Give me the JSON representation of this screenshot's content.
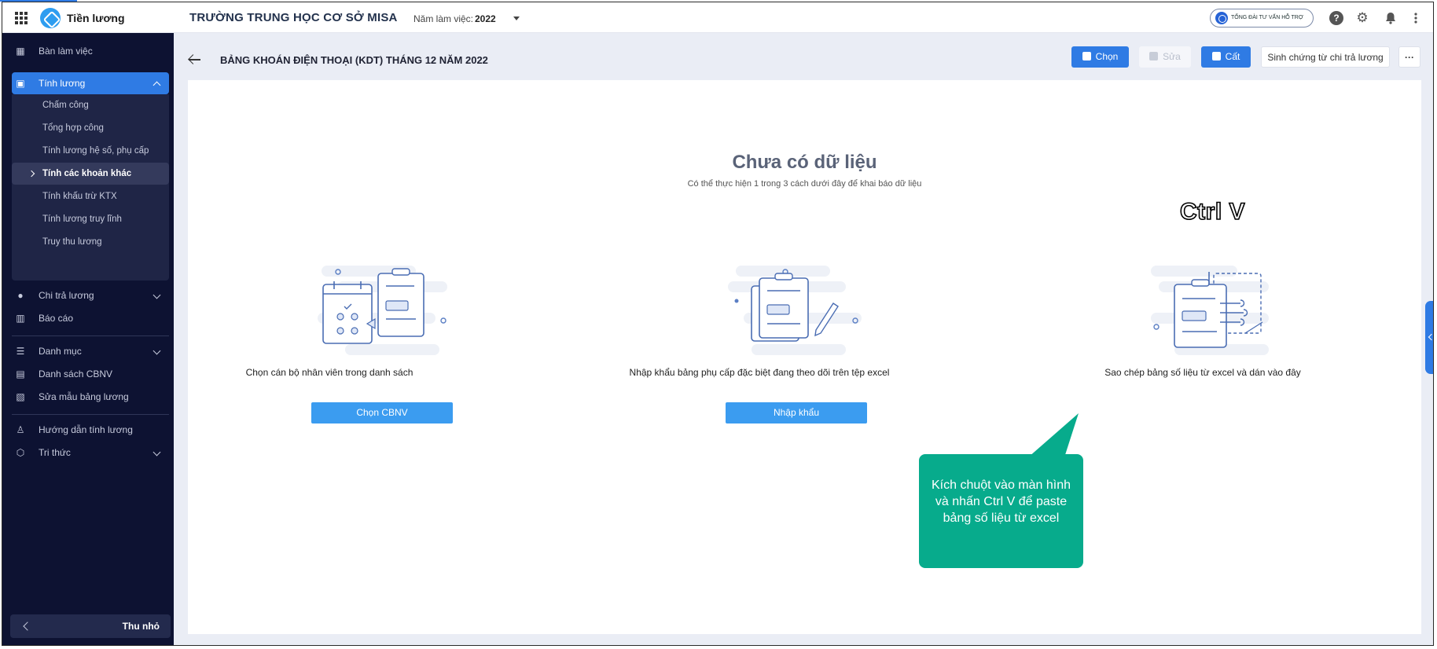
{
  "topbar": {
    "app_name": "Tiền lương",
    "school": "TRƯỜNG TRUNG HỌC CƠ SỞ MISA",
    "year_label": "Năm làm việc:",
    "year_value": "2022",
    "hotline": "TỔNG ĐÀI TƯ VẤN HỖ TRỢ"
  },
  "sidebar": {
    "items": [
      {
        "label": "Bàn làm việc"
      },
      {
        "label": "Tính lương"
      },
      {
        "label": "Chi trả lương"
      },
      {
        "label": "Báo cáo"
      },
      {
        "label": "Danh mục"
      },
      {
        "label": "Danh sách CBNV"
      },
      {
        "label": "Sửa mẫu bảng lương"
      },
      {
        "label": "Hướng dẫn tính lương"
      },
      {
        "label": "Tri thức"
      }
    ],
    "submenu": [
      {
        "label": "Chấm công"
      },
      {
        "label": "Tổng hợp công"
      },
      {
        "label": "Tính lương hệ số, phụ cấp"
      },
      {
        "label": "Tính các khoản khác"
      },
      {
        "label": "Tính khấu trừ KTX"
      },
      {
        "label": "Tính lương truy lĩnh"
      },
      {
        "label": "Truy thu lương"
      }
    ],
    "collapse_label": "Thu nhỏ"
  },
  "header": {
    "title": "BẢNG KHOÁN ĐIỆN THOẠI (KDT) THÁNG 12 NĂM 2022",
    "btn_choose": "Chọn",
    "btn_edit": "Sửa",
    "btn_save": "Cất",
    "btn_generate": "Sinh chứng từ chi trả lương",
    "btn_more": "···"
  },
  "empty": {
    "title": "Chưa có dữ liệu",
    "subtitle": "Có thể thực hiện 1 trong 3 cách dưới đây để khai báo dữ liệu",
    "ctrlv": "Ctrl V",
    "options": [
      {
        "label": "Chọn cán bộ nhân viên trong danh sách",
        "button": "Chọn CBNV"
      },
      {
        "label": "Nhập khẩu bảng phụ cấp đặc biệt đang theo dõi trên tệp excel",
        "button": "Nhập khẩu"
      },
      {
        "label": "Sao chép bảng số liệu từ excel và dán vào đây"
      }
    ]
  },
  "callout": {
    "text": "Kích chuột vào màn hình và nhấn Ctrl V để paste bảng số liệu từ excel"
  },
  "colors": {
    "sidebar_bg": "#0d1232",
    "accent": "#2f7be4",
    "callout": "#07ab8c"
  }
}
